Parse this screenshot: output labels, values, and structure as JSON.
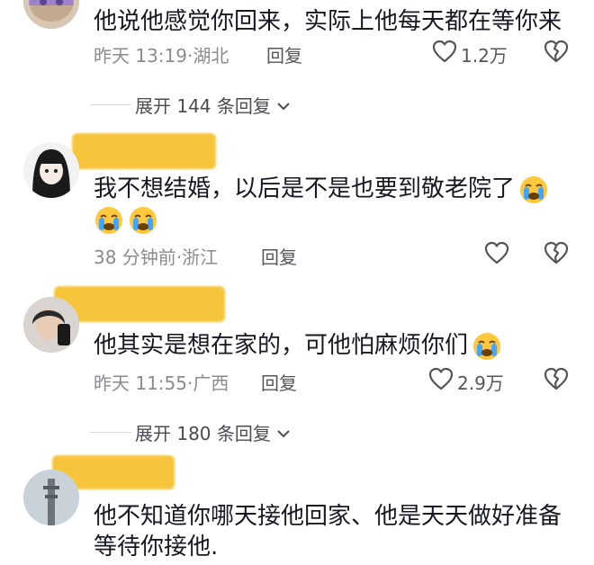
{
  "comments": [
    {
      "text": "他说他感觉你回来，实际上他每天都在等你来",
      "time": "昨天 13:19",
      "dot": "·",
      "location": "湖北",
      "reply": "回复",
      "likes": "1.2万"
    },
    {
      "text": "我不想结婚，以后是不是也要到敬老院了",
      "time": "38 分钟前",
      "dot": "·",
      "location": "浙江",
      "reply": "回复",
      "likes": ""
    },
    {
      "text": "他其实是想在家的，可他怕麻烦你们",
      "time": "昨天 11:55",
      "dot": "·",
      "location": "广西",
      "reply": "回复",
      "likes": "2.9万"
    },
    {
      "text_line1": "他不知道你哪天接他回家、他是天天做好准备",
      "text_line2": "等待你接他."
    }
  ],
  "expand1": "展开 144 条回复",
  "expand2": "展开 180 条回复",
  "icons": {
    "like": "heart-outline-icon",
    "dislike": "broken-heart-icon",
    "expand": "chevron-down-icon",
    "emoji": "loudly-crying-face-emoji"
  },
  "colors": {
    "name_highlight": "#f7c53c",
    "meta": "#8a8b91"
  }
}
